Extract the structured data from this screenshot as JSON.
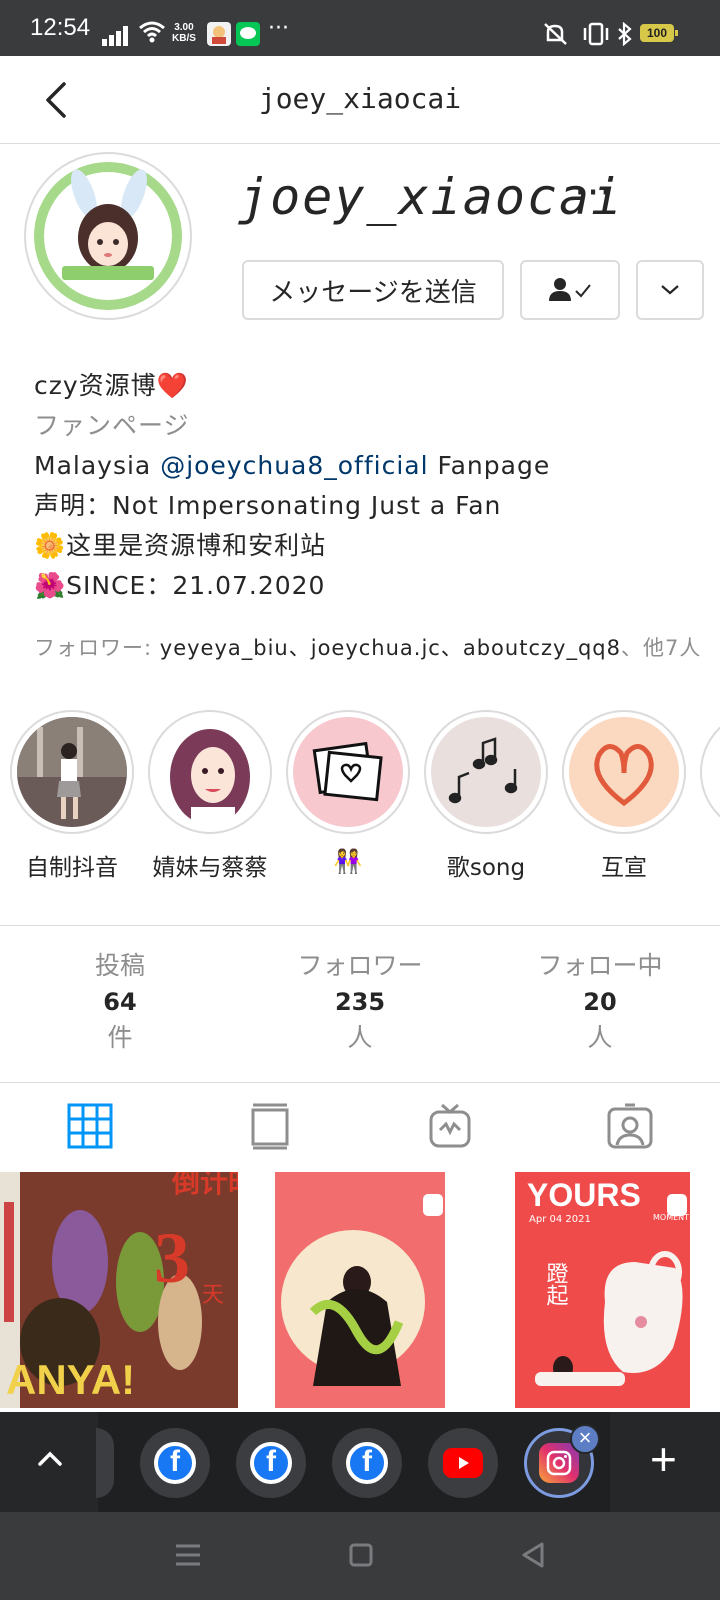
{
  "status_bar": {
    "time": "12:54",
    "net_speed_value": "3.00",
    "net_speed_unit": "KB/S",
    "more": "···",
    "battery": "100"
  },
  "header": {
    "title": "joey_xiaocai"
  },
  "profile": {
    "username": "joey_xiaocai",
    "more_icon": "···",
    "message_button": "メッセージを送信",
    "following_icon": "person-check-icon",
    "dropdown_icon": "chevron-down-icon"
  },
  "bio": {
    "name": "czy资源博❤️",
    "category": "ファンページ",
    "line1_prefix": "Malaysia ",
    "line1_mention": "@joeychua8_official",
    "line1_suffix": " Fanpage",
    "line2": "声明：Not Impersonating Just a Fan",
    "line3": "🌼这里是资源博和安利站",
    "line4": "🌺SINCE：21.07.2020"
  },
  "followed_by": {
    "label": "フォロワー: ",
    "names": "yeyeya_biu、joeychua.jc、aboutczy_qq8",
    "others": "、他7人"
  },
  "highlights": [
    {
      "label": "自制抖音"
    },
    {
      "label": "婧妹与蔡蔡"
    },
    {
      "label": "👭"
    },
    {
      "label": "歌song"
    },
    {
      "label": "互宣"
    }
  ],
  "stats": [
    {
      "label": "投稿",
      "value": "64",
      "unit": "件"
    },
    {
      "label": "フォロワー",
      "value": "235",
      "unit": "人"
    },
    {
      "label": "フォロー中",
      "value": "20",
      "unit": "人"
    }
  ],
  "tabs": [
    "grid-icon",
    "feed-icon",
    "igtv-icon",
    "tagged-icon"
  ],
  "posts": [
    {
      "text_top": "倒计时",
      "big": "3",
      "side": "天",
      "bottom": "ANYA!"
    },
    {
      "tag": "magazine"
    },
    {
      "header": "YOURS",
      "sub": "Apr 04 2021",
      "side": "MOMENT",
      "vertical": "蹬起"
    }
  ],
  "dock": {
    "apps": [
      "facebook-icon",
      "facebook-icon",
      "facebook-icon",
      "youtube-icon",
      "instagram-icon"
    ],
    "close": "×",
    "add": "+"
  },
  "colors": {
    "accent_blue": "#0095f6",
    "link": "#00376b",
    "muted": "#8e8e8e",
    "border": "#dbdbdb"
  }
}
